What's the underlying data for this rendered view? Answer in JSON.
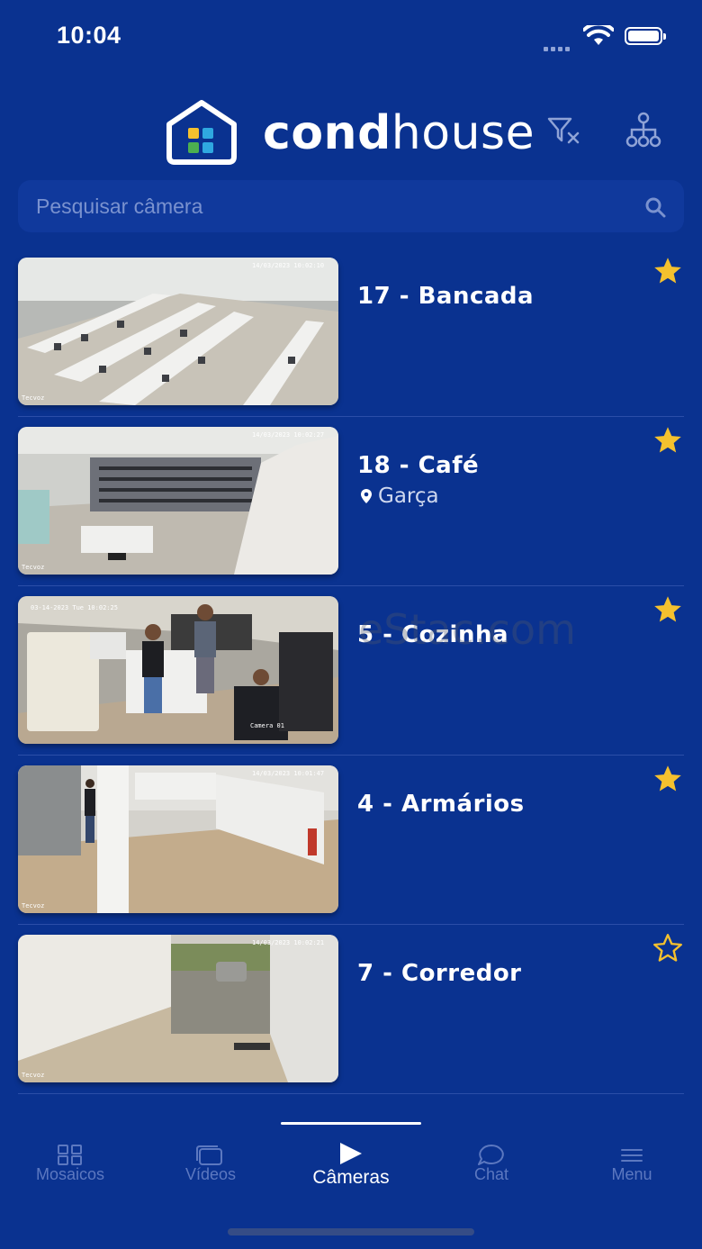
{
  "status": {
    "time": "10:04"
  },
  "header": {
    "logo_text_bold": "cond",
    "logo_text_light": "house"
  },
  "search": {
    "placeholder": "Pesquisar câmera"
  },
  "cameras": [
    {
      "name": "17 - Bancada",
      "location": "",
      "favorite": true
    },
    {
      "name": "18 - Café",
      "location": "Garça",
      "favorite": true
    },
    {
      "name": "5 - Cozinha",
      "location": "",
      "favorite": true
    },
    {
      "name": "4 - Armários",
      "location": "",
      "favorite": true
    },
    {
      "name": "7 - Corredor",
      "location": "",
      "favorite": false
    }
  ],
  "watermark": "eStac.com",
  "tabs": [
    {
      "label": "Mosaicos",
      "icon": "grid-icon"
    },
    {
      "label": "Vídeos",
      "icon": "videos-icon"
    },
    {
      "label": "Câmeras",
      "icon": "play-icon",
      "active": true
    },
    {
      "label": "Chat",
      "icon": "chat-icon"
    },
    {
      "label": "Menu",
      "icon": "menu-icon"
    }
  ],
  "colors": {
    "background": "#0a3290",
    "accent_star": "#f5c12e",
    "inactive_tab": "#5c78c0"
  }
}
